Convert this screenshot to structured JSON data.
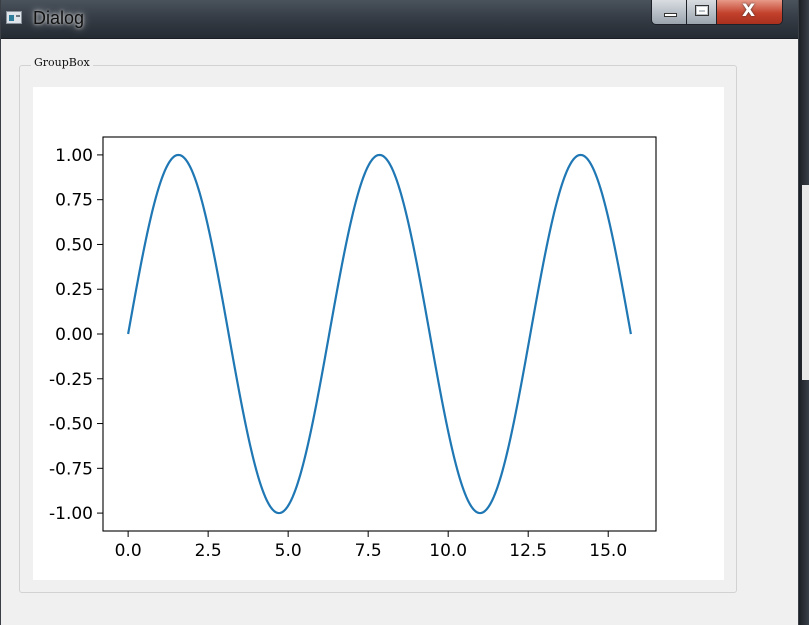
{
  "window": {
    "title": "Dialog"
  },
  "caption": {
    "close_glyph": "X"
  },
  "groupbox": {
    "title": "GroupBox"
  },
  "chart_data": {
    "type": "line",
    "title": "",
    "xlabel": "",
    "ylabel": "",
    "function": "sin(x)",
    "xlim": [
      -0.785,
      16.493
    ],
    "ylim": [
      -1.1,
      1.1
    ],
    "x_ticks": [
      0.0,
      2.5,
      5.0,
      7.5,
      10.0,
      12.5,
      15.0
    ],
    "x_tick_labels": [
      "0.0",
      "2.5",
      "5.0",
      "7.5",
      "10.0",
      "12.5",
      "15.0"
    ],
    "y_ticks": [
      1.0,
      0.75,
      0.5,
      0.25,
      0.0,
      -0.25,
      -0.5,
      -0.75,
      -1.0
    ],
    "y_tick_labels": [
      "1.00",
      "0.75",
      "0.50",
      "0.25",
      "0.00",
      "-0.25",
      "-0.50",
      "-0.75",
      "-1.00"
    ],
    "grid": false,
    "series": [
      {
        "color": "#1f77b4",
        "x": [
          0.0,
          0.785,
          1.571,
          2.356,
          3.142,
          3.927,
          4.712,
          5.498,
          6.283,
          7.069,
          7.854,
          8.639,
          9.425,
          10.21,
          10.996,
          11.781,
          12.566,
          13.352,
          14.137,
          14.923,
          15.708
        ],
        "values": [
          0.0,
          0.707,
          1.0,
          0.707,
          0.0,
          -0.707,
          -1.0,
          -0.707,
          0.0,
          0.707,
          1.0,
          0.707,
          0.0,
          -0.707,
          -1.0,
          -0.707,
          0.0,
          0.707,
          1.0,
          0.707,
          0.0
        ]
      }
    ]
  }
}
